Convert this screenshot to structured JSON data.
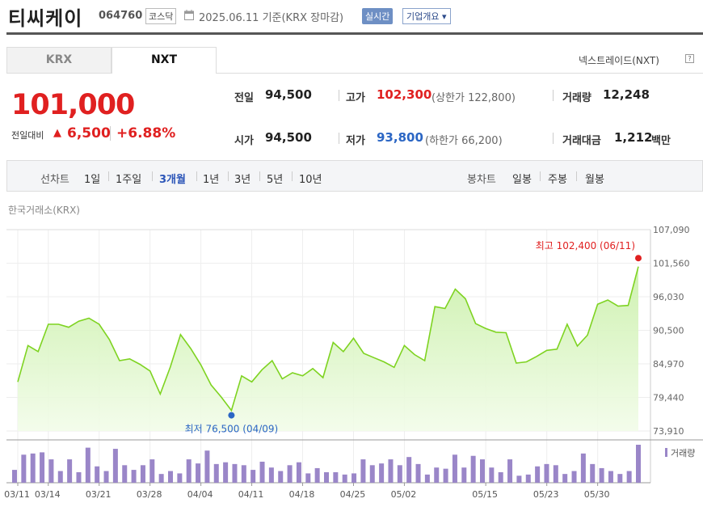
{
  "header": {
    "name": "티씨케이",
    "code": "064760",
    "market": "코스닥",
    "date_text": "2025.06.11  기준(KRX 장마감)",
    "realtime_label": "실시간",
    "company_button": "기업개요 ▾"
  },
  "tabs": [
    "KRX",
    "NXT"
  ],
  "nxt_link": "넥스트레이드(NXT)",
  "nxt_help": "?",
  "price": {
    "current": "101,000",
    "change_label": "전일대비",
    "change_arrow": "▲",
    "change_value": "6,500",
    "change_pct": "+6.88%"
  },
  "quotes": {
    "prev_label": "전일",
    "prev_value": "94,500",
    "open_label": "시가",
    "open_value": "94,500",
    "high_label": "고가",
    "high_value": "102,300",
    "upper_limit_text": "(상한가 122,800)",
    "low_label": "저가",
    "low_value": "93,800",
    "lower_limit_text": "(하한가 66,200)",
    "volume_label": "거래량",
    "volume_value": "12,248",
    "amount_label": "거래대금",
    "amount_value": "1,212",
    "amount_unit": "백만"
  },
  "periods": {
    "line_label": "선차트",
    "line_options": [
      "1일",
      "1주일",
      "3개월",
      "1년",
      "3년",
      "5년",
      "10년"
    ],
    "selected": "3개월",
    "candle_label": "봉차트",
    "candle_options": [
      "일봉",
      "주봉",
      "월봉"
    ]
  },
  "exchange_label": "한국거래소(KRX)",
  "colors": {
    "up": "#e02020",
    "down": "#2b66c4",
    "line": "#7ed321",
    "volume": "#9a86c8"
  },
  "chart_data": {
    "type": "area",
    "y_ticks": [
      "107,090",
      "101,560",
      "96,030",
      "90,500",
      "84,970",
      "79,440",
      "73,910"
    ],
    "ylim": [
      73910,
      107090
    ],
    "x_labels": [
      "03/11",
      "03/14",
      "03/21",
      "03/28",
      "04/04",
      "04/11",
      "04/18",
      "04/25",
      "05/02",
      "05/15",
      "05/23",
      "05/30"
    ],
    "x_label_index": [
      0,
      3,
      8,
      13,
      18,
      23,
      28,
      33,
      38,
      46,
      52,
      57
    ],
    "values": [
      82000,
      88000,
      87000,
      91500,
      91500,
      91000,
      92000,
      92500,
      91500,
      89000,
      85500,
      85800,
      84900,
      83800,
      80000,
      84500,
      89800,
      87500,
      84800,
      81500,
      79500,
      77300,
      83000,
      82000,
      84000,
      85500,
      82500,
      83500,
      83000,
      84200,
      82700,
      88500,
      87000,
      89200,
      86700,
      86000,
      85300,
      84400,
      88000,
      86500,
      85500,
      94400,
      94100,
      97300,
      95700,
      91600,
      90800,
      90200,
      90100,
      85100,
      85300,
      86200,
      87200,
      87400,
      91500,
      87900,
      89700,
      94800,
      95500,
      94500,
      94600,
      101000
    ],
    "volumes": [
      22,
      48,
      50,
      52,
      40,
      20,
      40,
      18,
      60,
      28,
      20,
      58,
      30,
      22,
      30,
      40,
      15,
      20,
      16,
      40,
      33,
      55,
      32,
      35,
      32,
      30,
      22,
      36,
      26,
      20,
      30,
      35,
      16,
      25,
      18,
      18,
      14,
      16,
      40,
      30,
      33,
      40,
      30,
      44,
      32,
      14,
      26,
      24,
      48,
      26,
      46,
      40,
      26,
      18,
      40,
      12,
      14,
      28,
      32,
      30,
      15,
      20,
      50,
      32,
      25,
      20,
      15,
      20,
      65
    ],
    "max_label": "최고 102,400 (06/11)",
    "min_label": "최저 76,500 (04/09)",
    "max_value": 102400,
    "min_value": 76500,
    "min_index": 21,
    "volume_legend": "거래량"
  }
}
